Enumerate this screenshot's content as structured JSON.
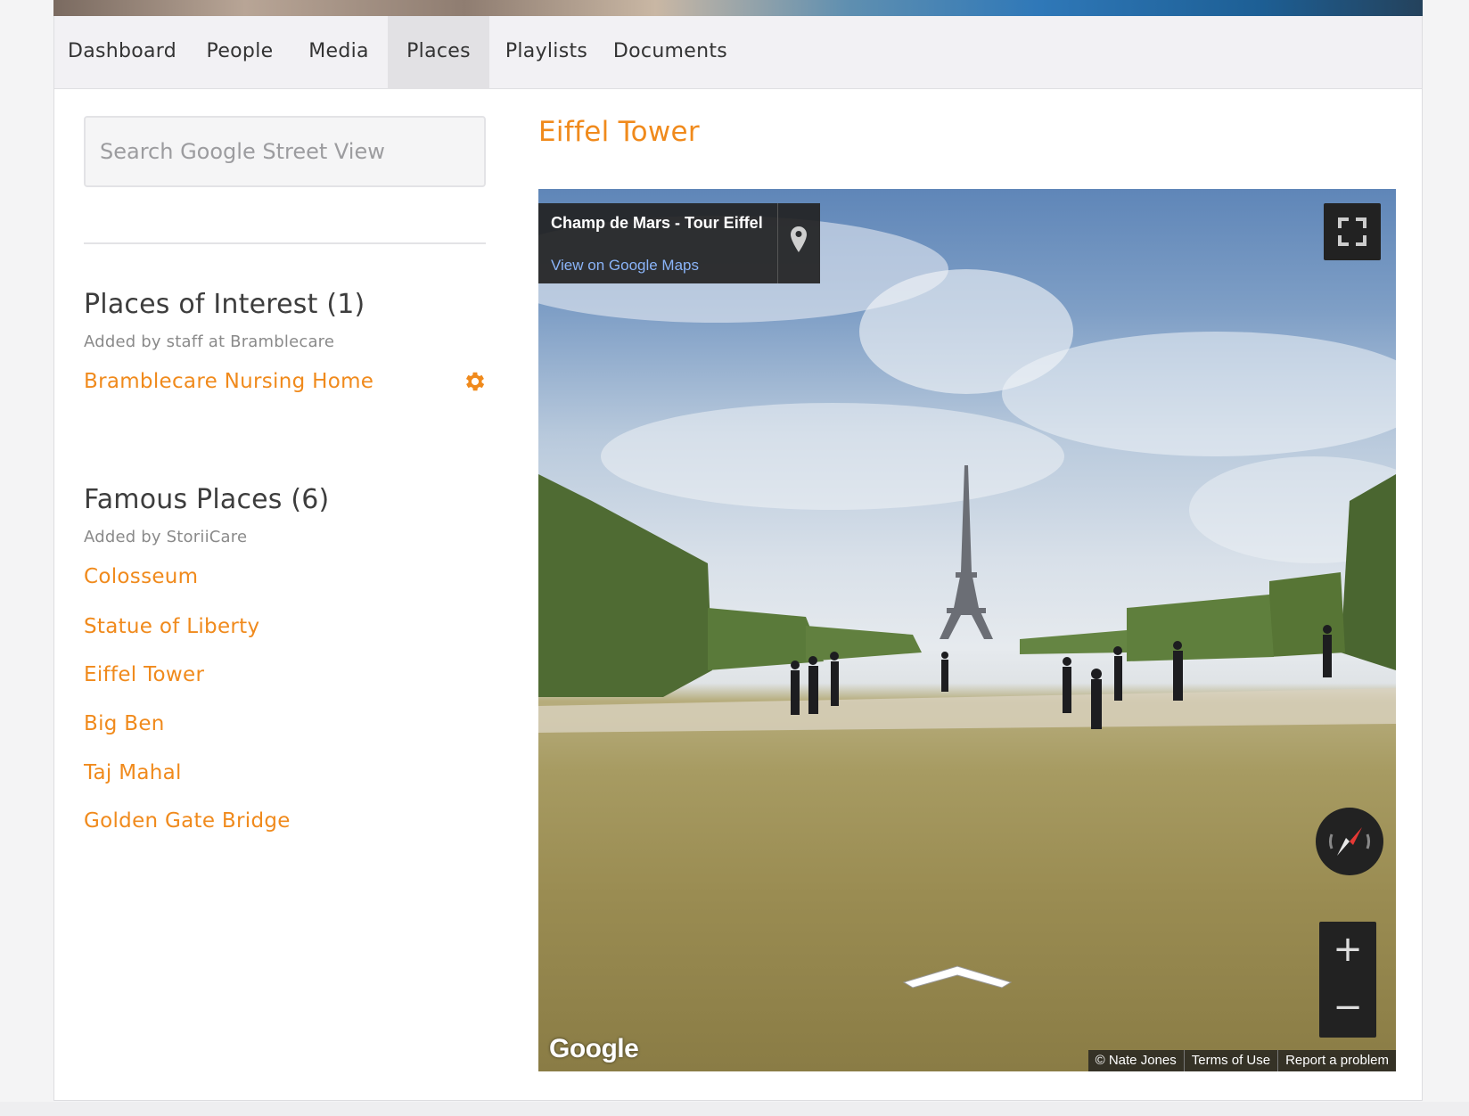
{
  "nav": {
    "tabs": [
      {
        "label": "Dashboard"
      },
      {
        "label": "People"
      },
      {
        "label": "Media"
      },
      {
        "label": "Places"
      },
      {
        "label": "Playlists"
      },
      {
        "label": "Documents"
      }
    ],
    "active_tab": "Places"
  },
  "sidebar": {
    "search_placeholder": "Search Google Street View",
    "interest": {
      "title": "Places of Interest (1)",
      "subtitle": "Added by staff at Bramblecare",
      "items": [
        {
          "label": "Bramblecare Nursing Home"
        }
      ]
    },
    "famous": {
      "title": "Famous Places (6)",
      "subtitle": "Added by StoriiCare",
      "items": [
        {
          "label": "Colosseum"
        },
        {
          "label": "Statue of Liberty"
        },
        {
          "label": "Eiffel Tower"
        },
        {
          "label": "Big Ben"
        },
        {
          "label": "Taj Mahal"
        },
        {
          "label": "Golden Gate Bridge"
        }
      ]
    }
  },
  "main": {
    "title": "Eiffel Tower",
    "streetview": {
      "location_name": "Champ de Mars - Tour Eiffel",
      "maps_link": "View on Google Maps",
      "logo": "Google",
      "zoom_in": "+",
      "zoom_out": "−",
      "attribution": [
        "© Nate Jones",
        "Terms of Use",
        "Report a problem"
      ]
    }
  },
  "colors": {
    "accent": "#f08a1c",
    "active_tab_bg": "#e2e1e4"
  }
}
